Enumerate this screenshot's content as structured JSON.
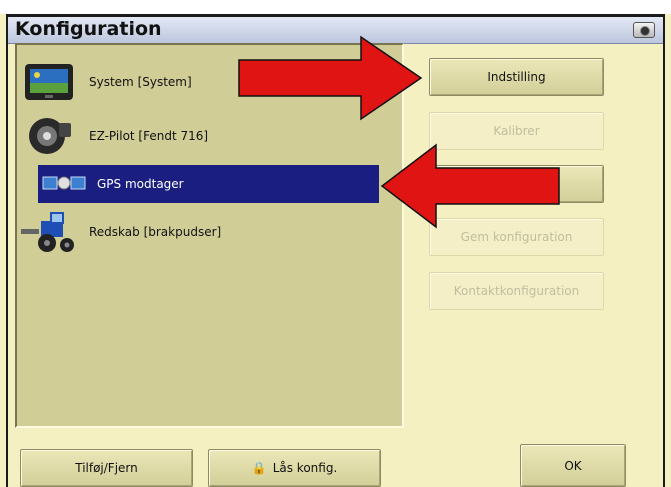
{
  "window": {
    "title": "Konfiguration",
    "title_icon": "camera-icon"
  },
  "tree": {
    "items": [
      {
        "label": "System [System]",
        "icon": "display-terminal-icon"
      },
      {
        "label": "EZ-Pilot [Fendt 716]",
        "icon": "steering-motor-icon"
      },
      {
        "label": "GPS modtager",
        "icon": "satellite-icon",
        "selected": true
      },
      {
        "label": "Redskab [brakpudser]",
        "icon": "tractor-icon"
      }
    ]
  },
  "buttons": {
    "setup": "Indstilling",
    "calibrate": "Kalibrer",
    "save_config": "Gem konfiguration",
    "contact_config": "Kontaktkonfiguration",
    "add_remove": "Tilføj/Fjern",
    "lock_config": "Lås konfig.",
    "ok": "OK"
  },
  "colors": {
    "background": "#f5f0c2",
    "panel": "#d1cd97",
    "selection": "#1a1e80",
    "callout_arrow": "#e11414"
  }
}
